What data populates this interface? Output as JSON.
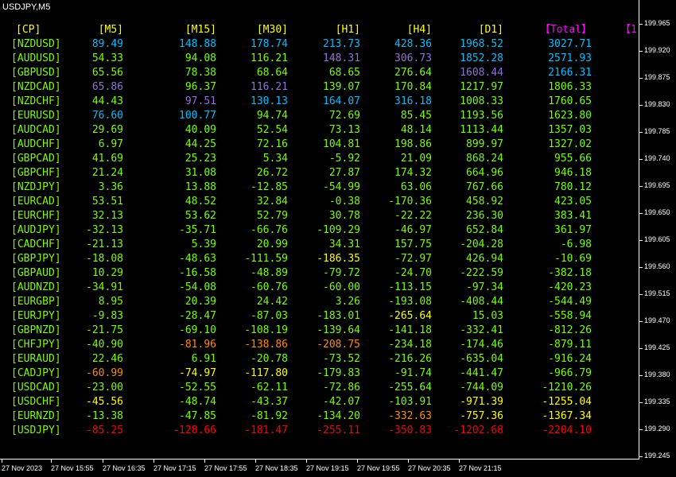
{
  "window": {
    "title": "USDJPY,M5"
  },
  "table": {
    "headers": [
      {
        "label": "[CP]",
        "color": "#ffff00"
      },
      {
        "label": "[M5]",
        "color": "#ffff00"
      },
      {
        "label": "[M15]",
        "color": "#ffff00"
      },
      {
        "label": "[M30]",
        "color": "#ffff00"
      },
      {
        "label": "[H1]",
        "color": "#ffff00"
      },
      {
        "label": "[H4]",
        "color": "#ffff00"
      },
      {
        "label": "[D1]",
        "color": "#ffff00"
      },
      {
        "label": "【Total】",
        "color": "#ff00ff"
      },
      {
        "label": "【1",
        "color": "#ff00ff"
      }
    ],
    "rows": [
      {
        "symbol": "[NZDUSD]",
        "cells": [
          {
            "v": "89.49",
            "c": "#00bfff"
          },
          {
            "v": "148.88",
            "c": "#00bfff"
          },
          {
            "v": "178.74",
            "c": "#00bfff"
          },
          {
            "v": "213.73",
            "c": "#00bfff"
          },
          {
            "v": "428.36",
            "c": "#00bfff"
          },
          {
            "v": "1968.52",
            "c": "#00bfff"
          },
          {
            "v": "3027.71",
            "c": "#00bfff"
          }
        ]
      },
      {
        "symbol": "[AUDUSD]",
        "cells": [
          {
            "v": "54.33",
            "c": "#7cfc00"
          },
          {
            "v": "94.08",
            "c": "#7cfc00"
          },
          {
            "v": "116.21",
            "c": "#7cfc00"
          },
          {
            "v": "148.31",
            "c": "#9370db"
          },
          {
            "v": "306.73",
            "c": "#9370db"
          },
          {
            "v": "1852.28",
            "c": "#00bfff"
          },
          {
            "v": "2571.93",
            "c": "#00bfff"
          }
        ]
      },
      {
        "symbol": "[GBPUSD]",
        "cells": [
          {
            "v": "65.56",
            "c": "#7cfc00"
          },
          {
            "v": "78.38",
            "c": "#7cfc00"
          },
          {
            "v": "68.64",
            "c": "#7cfc00"
          },
          {
            "v": "68.65",
            "c": "#7cfc00"
          },
          {
            "v": "276.64",
            "c": "#7cfc00"
          },
          {
            "v": "1608.44",
            "c": "#9370db"
          },
          {
            "v": "2166.31",
            "c": "#00bfff"
          }
        ]
      },
      {
        "symbol": "[NZDCAD]",
        "cells": [
          {
            "v": "65.86",
            "c": "#9370db"
          },
          {
            "v": "96.37",
            "c": "#7cfc00"
          },
          {
            "v": "116.21",
            "c": "#9370db"
          },
          {
            "v": "139.07",
            "c": "#7cfc00"
          },
          {
            "v": "170.84",
            "c": "#7cfc00"
          },
          {
            "v": "1217.97",
            "c": "#7cfc00"
          },
          {
            "v": "1806.33",
            "c": "#7cfc00"
          }
        ]
      },
      {
        "symbol": "[NZDCHF]",
        "cells": [
          {
            "v": "44.43",
            "c": "#7cfc00"
          },
          {
            "v": "97.51",
            "c": "#9370db"
          },
          {
            "v": "130.13",
            "c": "#00bfff"
          },
          {
            "v": "164.07",
            "c": "#00bfff"
          },
          {
            "v": "316.18",
            "c": "#00bfff"
          },
          {
            "v": "1008.33",
            "c": "#7cfc00"
          },
          {
            "v": "1760.65",
            "c": "#7cfc00"
          }
        ]
      },
      {
        "symbol": "[EURUSD]",
        "cells": [
          {
            "v": "76.60",
            "c": "#00bfff"
          },
          {
            "v": "100.77",
            "c": "#00bfff"
          },
          {
            "v": "94.74",
            "c": "#7cfc00"
          },
          {
            "v": "72.69",
            "c": "#7cfc00"
          },
          {
            "v": "85.45",
            "c": "#7cfc00"
          },
          {
            "v": "1193.56",
            "c": "#7cfc00"
          },
          {
            "v": "1623.80",
            "c": "#7cfc00"
          }
        ]
      },
      {
        "symbol": "[AUDCAD]",
        "cells": [
          {
            "v": "29.69",
            "c": "#7cfc00"
          },
          {
            "v": "40.09",
            "c": "#7cfc00"
          },
          {
            "v": "52.54",
            "c": "#7cfc00"
          },
          {
            "v": "73.13",
            "c": "#7cfc00"
          },
          {
            "v": "48.14",
            "c": "#7cfc00"
          },
          {
            "v": "1113.44",
            "c": "#7cfc00"
          },
          {
            "v": "1357.03",
            "c": "#7cfc00"
          }
        ]
      },
      {
        "symbol": "[AUDCHF]",
        "cells": [
          {
            "v": "6.97",
            "c": "#7cfc00"
          },
          {
            "v": "44.25",
            "c": "#7cfc00"
          },
          {
            "v": "72.16",
            "c": "#7cfc00"
          },
          {
            "v": "104.81",
            "c": "#7cfc00"
          },
          {
            "v": "198.86",
            "c": "#7cfc00"
          },
          {
            "v": "899.97",
            "c": "#7cfc00"
          },
          {
            "v": "1327.02",
            "c": "#7cfc00"
          }
        ]
      },
      {
        "symbol": "[GBPCAD]",
        "cells": [
          {
            "v": "41.69",
            "c": "#7cfc00"
          },
          {
            "v": "25.23",
            "c": "#7cfc00"
          },
          {
            "v": "5.34",
            "c": "#7cfc00"
          },
          {
            "v": "-5.92",
            "c": "#7cfc00"
          },
          {
            "v": "21.09",
            "c": "#7cfc00"
          },
          {
            "v": "868.24",
            "c": "#7cfc00"
          },
          {
            "v": "955.66",
            "c": "#7cfc00"
          }
        ]
      },
      {
        "symbol": "[GBPCHF]",
        "cells": [
          {
            "v": "21.24",
            "c": "#7cfc00"
          },
          {
            "v": "31.08",
            "c": "#7cfc00"
          },
          {
            "v": "26.72",
            "c": "#7cfc00"
          },
          {
            "v": "27.87",
            "c": "#7cfc00"
          },
          {
            "v": "174.32",
            "c": "#7cfc00"
          },
          {
            "v": "664.96",
            "c": "#7cfc00"
          },
          {
            "v": "946.18",
            "c": "#7cfc00"
          }
        ]
      },
      {
        "symbol": "[NZDJPY]",
        "cells": [
          {
            "v": "3.36",
            "c": "#7cfc00"
          },
          {
            "v": "13.88",
            "c": "#7cfc00"
          },
          {
            "v": "-12.85",
            "c": "#7cfc00"
          },
          {
            "v": "-54.99",
            "c": "#7cfc00"
          },
          {
            "v": "63.06",
            "c": "#7cfc00"
          },
          {
            "v": "767.66",
            "c": "#7cfc00"
          },
          {
            "v": "780.12",
            "c": "#7cfc00"
          }
        ]
      },
      {
        "symbol": "[EURCAD]",
        "cells": [
          {
            "v": "53.51",
            "c": "#7cfc00"
          },
          {
            "v": "48.52",
            "c": "#7cfc00"
          },
          {
            "v": "32.84",
            "c": "#7cfc00"
          },
          {
            "v": "-0.38",
            "c": "#7cfc00"
          },
          {
            "v": "-170.36",
            "c": "#7cfc00"
          },
          {
            "v": "458.92",
            "c": "#7cfc00"
          },
          {
            "v": "423.05",
            "c": "#7cfc00"
          }
        ]
      },
      {
        "symbol": "[EURCHF]",
        "cells": [
          {
            "v": "32.13",
            "c": "#7cfc00"
          },
          {
            "v": "53.62",
            "c": "#7cfc00"
          },
          {
            "v": "52.79",
            "c": "#7cfc00"
          },
          {
            "v": "30.78",
            "c": "#7cfc00"
          },
          {
            "v": "-22.22",
            "c": "#7cfc00"
          },
          {
            "v": "236.30",
            "c": "#7cfc00"
          },
          {
            "v": "383.41",
            "c": "#7cfc00"
          }
        ]
      },
      {
        "symbol": "[AUDJPY]",
        "cells": [
          {
            "v": "-32.13",
            "c": "#7cfc00"
          },
          {
            "v": "-35.71",
            "c": "#7cfc00"
          },
          {
            "v": "-66.76",
            "c": "#7cfc00"
          },
          {
            "v": "-109.29",
            "c": "#7cfc00"
          },
          {
            "v": "-46.97",
            "c": "#7cfc00"
          },
          {
            "v": "652.84",
            "c": "#7cfc00"
          },
          {
            "v": "361.97",
            "c": "#7cfc00"
          }
        ]
      },
      {
        "symbol": "[CADCHF]",
        "cells": [
          {
            "v": "-21.13",
            "c": "#7cfc00"
          },
          {
            "v": "5.39",
            "c": "#7cfc00"
          },
          {
            "v": "20.99",
            "c": "#7cfc00"
          },
          {
            "v": "34.31",
            "c": "#7cfc00"
          },
          {
            "v": "157.75",
            "c": "#7cfc00"
          },
          {
            "v": "-204.28",
            "c": "#7cfc00"
          },
          {
            "v": "-6.98",
            "c": "#7cfc00"
          }
        ]
      },
      {
        "symbol": "[GBPJPY]",
        "cells": [
          {
            "v": "-18.08",
            "c": "#7cfc00"
          },
          {
            "v": "-48.63",
            "c": "#7cfc00"
          },
          {
            "v": "-111.59",
            "c": "#7cfc00"
          },
          {
            "v": "-186.35",
            "c": "#ffff00"
          },
          {
            "v": "-72.97",
            "c": "#7cfc00"
          },
          {
            "v": "426.94",
            "c": "#7cfc00"
          },
          {
            "v": "-10.69",
            "c": "#7cfc00"
          }
        ]
      },
      {
        "symbol": "[GBPAUD]",
        "cells": [
          {
            "v": "10.29",
            "c": "#7cfc00"
          },
          {
            "v": "-16.58",
            "c": "#7cfc00"
          },
          {
            "v": "-48.89",
            "c": "#7cfc00"
          },
          {
            "v": "-79.72",
            "c": "#7cfc00"
          },
          {
            "v": "-24.70",
            "c": "#7cfc00"
          },
          {
            "v": "-222.59",
            "c": "#7cfc00"
          },
          {
            "v": "-382.18",
            "c": "#7cfc00"
          }
        ]
      },
      {
        "symbol": "[AUDNZD]",
        "cells": [
          {
            "v": "-34.91",
            "c": "#7cfc00"
          },
          {
            "v": "-54.08",
            "c": "#7cfc00"
          },
          {
            "v": "-60.76",
            "c": "#7cfc00"
          },
          {
            "v": "-60.00",
            "c": "#7cfc00"
          },
          {
            "v": "-113.15",
            "c": "#7cfc00"
          },
          {
            "v": "-97.34",
            "c": "#7cfc00"
          },
          {
            "v": "-420.23",
            "c": "#7cfc00"
          }
        ]
      },
      {
        "symbol": "[EURGBP]",
        "cells": [
          {
            "v": "8.95",
            "c": "#7cfc00"
          },
          {
            "v": "20.39",
            "c": "#7cfc00"
          },
          {
            "v": "24.42",
            "c": "#7cfc00"
          },
          {
            "v": "3.26",
            "c": "#7cfc00"
          },
          {
            "v": "-193.08",
            "c": "#7cfc00"
          },
          {
            "v": "-408.44",
            "c": "#7cfc00"
          },
          {
            "v": "-544.49",
            "c": "#7cfc00"
          }
        ]
      },
      {
        "symbol": "[EURJPY]",
        "cells": [
          {
            "v": "-9.83",
            "c": "#7cfc00"
          },
          {
            "v": "-28.47",
            "c": "#7cfc00"
          },
          {
            "v": "-87.03",
            "c": "#7cfc00"
          },
          {
            "v": "-183.01",
            "c": "#7cfc00"
          },
          {
            "v": "-265.64",
            "c": "#ffff00"
          },
          {
            "v": "15.03",
            "c": "#7cfc00"
          },
          {
            "v": "-558.94",
            "c": "#7cfc00"
          }
        ]
      },
      {
        "symbol": "[GBPNZD]",
        "cells": [
          {
            "v": "-21.75",
            "c": "#7cfc00"
          },
          {
            "v": "-69.10",
            "c": "#7cfc00"
          },
          {
            "v": "-108.19",
            "c": "#7cfc00"
          },
          {
            "v": "-139.64",
            "c": "#7cfc00"
          },
          {
            "v": "-141.18",
            "c": "#7cfc00"
          },
          {
            "v": "-332.41",
            "c": "#7cfc00"
          },
          {
            "v": "-812.26",
            "c": "#7cfc00"
          }
        ]
      },
      {
        "symbol": "[CHFJPY]",
        "cells": [
          {
            "v": "-40.90",
            "c": "#7cfc00"
          },
          {
            "v": "-81.96",
            "c": "#ff8c00"
          },
          {
            "v": "-138.86",
            "c": "#ff8c00"
          },
          {
            "v": "-208.75",
            "c": "#ff8c00"
          },
          {
            "v": "-234.18",
            "c": "#7cfc00"
          },
          {
            "v": "-174.46",
            "c": "#7cfc00"
          },
          {
            "v": "-879.11",
            "c": "#7cfc00"
          }
        ]
      },
      {
        "symbol": "[EURAUD]",
        "cells": [
          {
            "v": "22.46",
            "c": "#7cfc00"
          },
          {
            "v": "6.91",
            "c": "#7cfc00"
          },
          {
            "v": "-20.78",
            "c": "#7cfc00"
          },
          {
            "v": "-73.52",
            "c": "#7cfc00"
          },
          {
            "v": "-216.26",
            "c": "#7cfc00"
          },
          {
            "v": "-635.04",
            "c": "#7cfc00"
          },
          {
            "v": "-916.24",
            "c": "#7cfc00"
          }
        ]
      },
      {
        "symbol": "[CADJPY]",
        "cells": [
          {
            "v": "-60.99",
            "c": "#ff8c00"
          },
          {
            "v": "-74.97",
            "c": "#ffff00"
          },
          {
            "v": "-117.80",
            "c": "#ffff00"
          },
          {
            "v": "-179.83",
            "c": "#7cfc00"
          },
          {
            "v": "-91.74",
            "c": "#7cfc00"
          },
          {
            "v": "-441.47",
            "c": "#7cfc00"
          },
          {
            "v": "-966.79",
            "c": "#7cfc00"
          }
        ]
      },
      {
        "symbol": "[USDCAD]",
        "cells": [
          {
            "v": "-23.00",
            "c": "#7cfc00"
          },
          {
            "v": "-52.55",
            "c": "#7cfc00"
          },
          {
            "v": "-62.11",
            "c": "#7cfc00"
          },
          {
            "v": "-72.86",
            "c": "#7cfc00"
          },
          {
            "v": "-255.64",
            "c": "#7cfc00"
          },
          {
            "v": "-744.09",
            "c": "#7cfc00"
          },
          {
            "v": "-1210.26",
            "c": "#7cfc00"
          }
        ]
      },
      {
        "symbol": "[USDCHF]",
        "cells": [
          {
            "v": "-45.56",
            "c": "#ffff00"
          },
          {
            "v": "-48.74",
            "c": "#7cfc00"
          },
          {
            "v": "-43.37",
            "c": "#7cfc00"
          },
          {
            "v": "-42.07",
            "c": "#7cfc00"
          },
          {
            "v": "-103.91",
            "c": "#7cfc00"
          },
          {
            "v": "-971.39",
            "c": "#ffff00"
          },
          {
            "v": "-1255.04",
            "c": "#ffff00"
          }
        ]
      },
      {
        "symbol": "[EURNZD]",
        "cells": [
          {
            "v": "-13.38",
            "c": "#7cfc00"
          },
          {
            "v": "-47.85",
            "c": "#7cfc00"
          },
          {
            "v": "-81.92",
            "c": "#7cfc00"
          },
          {
            "v": "-134.20",
            "c": "#7cfc00"
          },
          {
            "v": "-332.63",
            "c": "#ff8c00"
          },
          {
            "v": "-757.36",
            "c": "#ffff00"
          },
          {
            "v": "-1367.34",
            "c": "#ffff00"
          }
        ]
      },
      {
        "symbol": "[USDJPY]",
        "cells": [
          {
            "v": "-85.25",
            "c": "#ff0000"
          },
          {
            "v": "-128.66",
            "c": "#ff0000"
          },
          {
            "v": "-181.47",
            "c": "#ff0000"
          },
          {
            "v": "-255.11",
            "c": "#ff0000"
          },
          {
            "v": "-350.83",
            "c": "#ff0000"
          },
          {
            "v": "-1202.68",
            "c": "#ff0000"
          },
          {
            "v": "-2204.10",
            "c": "#ff0000"
          }
        ]
      }
    ],
    "symbol_color": "#7cfc00"
  },
  "price_axis": [
    "199.965",
    "199.920",
    "199.875",
    "199.830",
    "199.785",
    "199.740",
    "199.695",
    "199.650",
    "199.605",
    "199.560",
    "199.515",
    "199.470",
    "199.425",
    "199.380",
    "199.335",
    "199.290",
    "199.245"
  ],
  "time_axis": [
    "27 Nov 2023",
    "27 Nov 15:55",
    "27 Nov 16:35",
    "27 Nov 17:15",
    "27 Nov 17:55",
    "27 Nov 18:35",
    "27 Nov 19:15",
    "27 Nov 19:55",
    "27 Nov 20:35",
    "27 Nov 21:15"
  ]
}
